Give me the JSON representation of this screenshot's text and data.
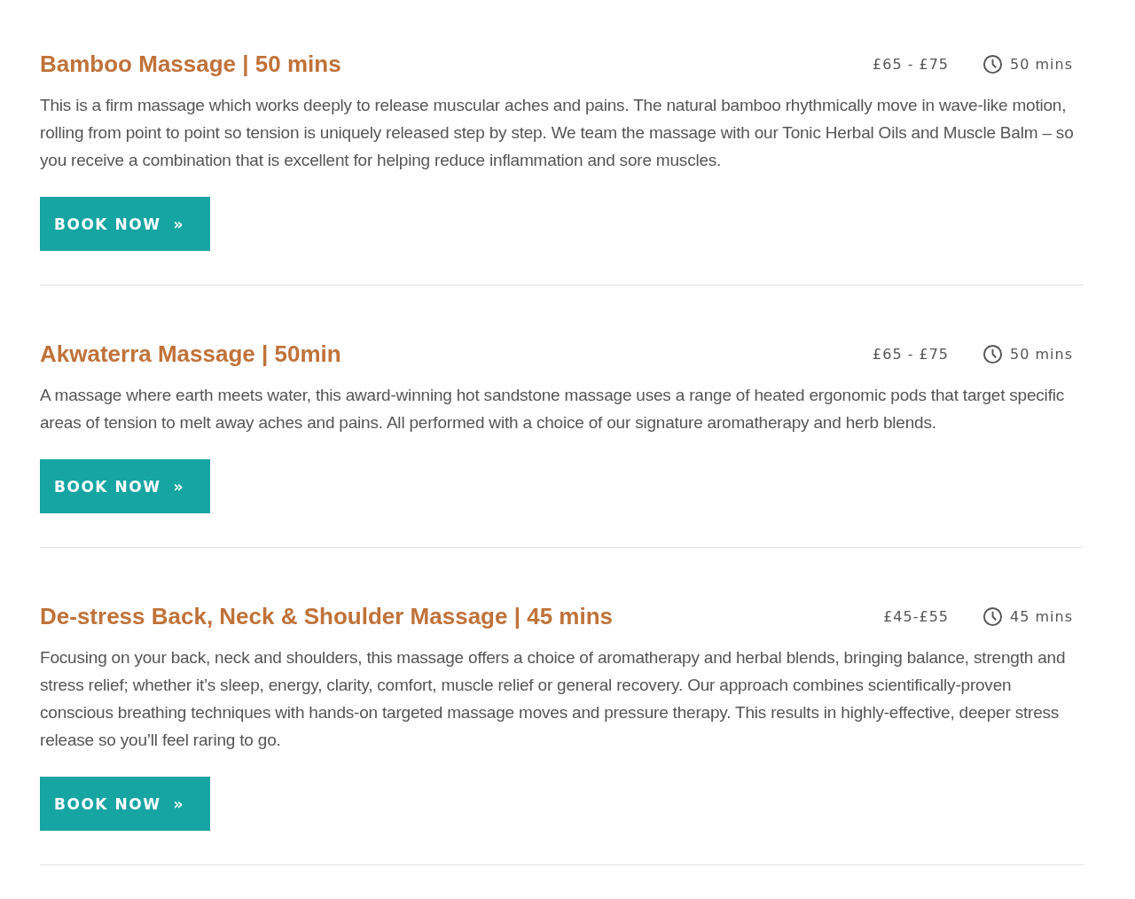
{
  "treatments": [
    {
      "title": "Bamboo Massage | 50 mins",
      "price": "£65 - £75",
      "duration": "50 mins",
      "description": "This is a firm massage which works deeply to release muscular aches and pains. The natural bamboo rhythmically move in wave-like motion, rolling from point to point so tension is uniquely released step by step. We team the massage with our Tonic Herbal Oils and Muscle Balm – so you receive a combination that is excellent for helping reduce inflammation and sore muscles.",
      "button": {
        "label": "BOOK NOW",
        "icon": "»"
      }
    },
    {
      "title": "Akwaterra Massage | 50min",
      "price": "£65 - £75",
      "duration": "50 mins",
      "description": "A massage where earth meets water, this award-winning hot sandstone massage uses a range of heated ergonomic pods that target specific areas of tension to melt away aches and pains. All performed with a choice of our signature aromatherapy and herb blends.",
      "button": {
        "label": "BOOK NOW",
        "icon": "»"
      }
    },
    {
      "title": "De-stress Back, Neck & Shoulder Massage | 45 mins",
      "price": "£45-£55",
      "duration": "45 mins",
      "description": "Focusing on your back, neck and shoulders, this massage offers a choice of aromatherapy and herbal blends, bringing balance, strength and stress relief; whether it’s sleep, energy, clarity, comfort, muscle relief or general recovery. Our approach combines scientifically-proven conscious breathing techniques with hands-on targeted massage moves and pressure therapy. This results in highly-effective, deeper stress release so you’ll feel raring to go.",
      "button": {
        "label": "BOOK NOW",
        "icon": "»"
      }
    }
  ]
}
